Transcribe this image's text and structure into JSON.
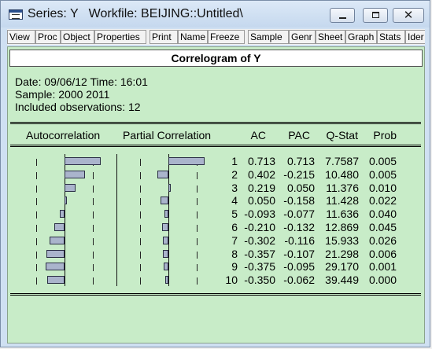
{
  "window": {
    "title": "Series: Y   Workfile: BEIJING::Untitled\\",
    "controls": {
      "minimize": "minimize",
      "maximize": "maximize",
      "close": "✕"
    }
  },
  "toolbar": [
    "View",
    "Proc",
    "Object",
    "Properties",
    "Print",
    "Name",
    "Freeze",
    "Sample",
    "Genr",
    "Sheet",
    "Graph",
    "Stats",
    "Ider"
  ],
  "report": {
    "title": "Correlogram of Y",
    "date_line": "Date: 09/06/12   Time: 16:01",
    "sample_line": "Sample: 2000 2011",
    "obs_line": "Included observations: 12",
    "columns": {
      "autocorrelation": "Autocorrelation",
      "partial_correlation": "Partial Correlation",
      "ac": "AC",
      "pac": "PAC",
      "qstat": "Q-Stat",
      "prob": "Prob"
    },
    "rows": [
      {
        "lag": "1",
        "ac": "0.713",
        "pac": "0.713",
        "q": "7.7587",
        "prob": "0.005"
      },
      {
        "lag": "2",
        "ac": "0.402",
        "pac": "-0.215",
        "q": "10.480",
        "prob": "0.005"
      },
      {
        "lag": "3",
        "ac": "0.219",
        "pac": "0.050",
        "q": "11.376",
        "prob": "0.010"
      },
      {
        "lag": "4",
        "ac": "0.050",
        "pac": "-0.158",
        "q": "11.428",
        "prob": "0.022"
      },
      {
        "lag": "5",
        "ac": "-0.093",
        "pac": "-0.077",
        "q": "11.636",
        "prob": "0.040"
      },
      {
        "lag": "6",
        "ac": "-0.210",
        "pac": "-0.132",
        "q": "12.869",
        "prob": "0.045"
      },
      {
        "lag": "7",
        "ac": "-0.302",
        "pac": "-0.116",
        "q": "15.933",
        "prob": "0.026"
      },
      {
        "lag": "8",
        "ac": "-0.357",
        "pac": "-0.107",
        "q": "21.298",
        "prob": "0.006"
      },
      {
        "lag": "9",
        "ac": "-0.375",
        "pac": "-0.095",
        "q": "29.170",
        "prob": "0.001"
      },
      {
        "lag": "10",
        "ac": "-0.350",
        "pac": "-0.062",
        "q": "39.449",
        "prob": "0.000"
      }
    ]
  },
  "colors": {
    "panel_background": "#c8ecc8",
    "bar_fill": "#aab4cc",
    "bar_border": "#2b2f46"
  }
}
